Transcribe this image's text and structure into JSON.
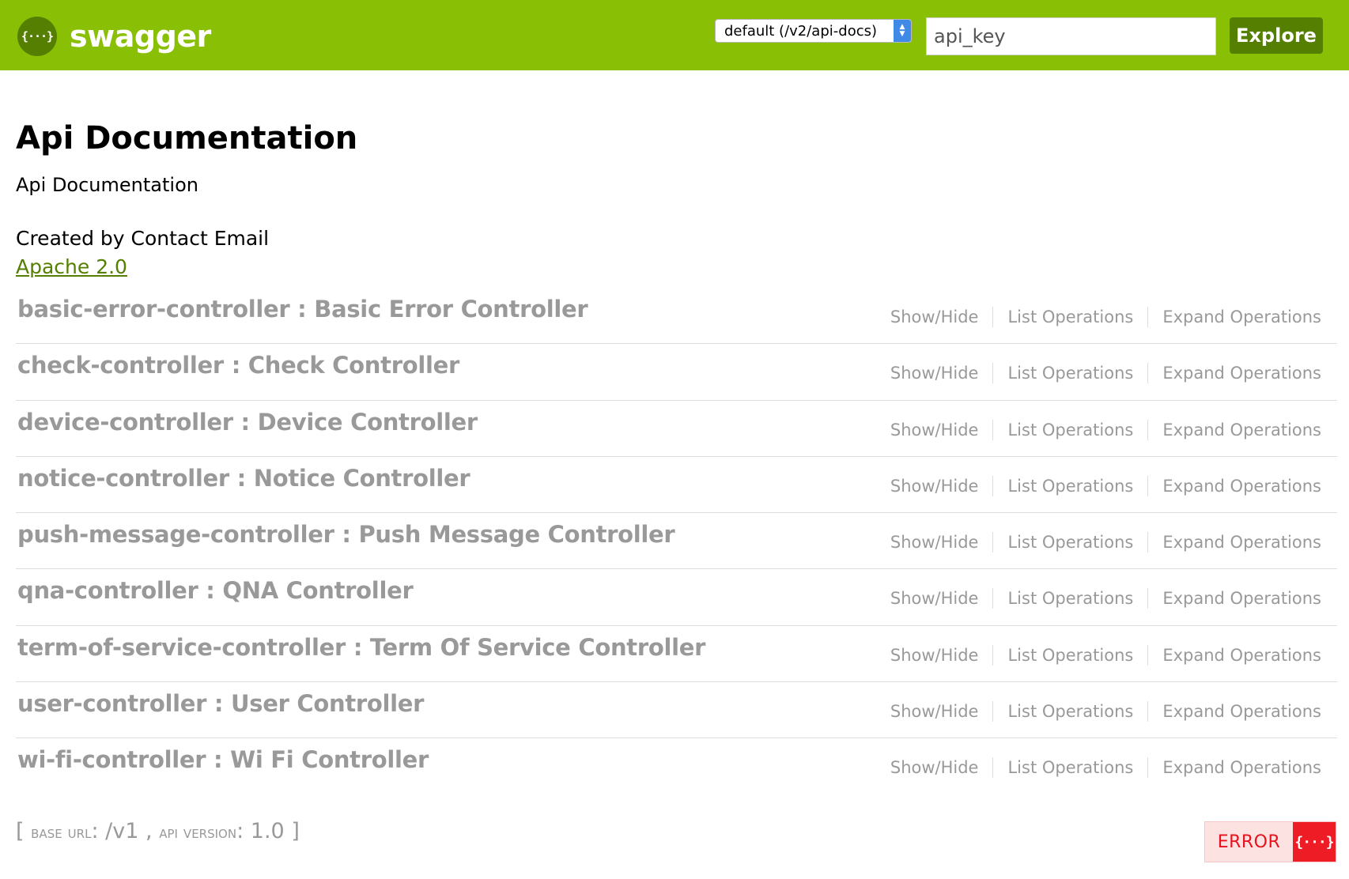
{
  "header": {
    "logo_icon": "swagger-braces-icon",
    "logo_icon_glyph": "{···}",
    "logo_text": "swagger",
    "spec_select": {
      "value": "default (/v2/api-docs)"
    },
    "api_key": {
      "value": "",
      "placeholder": "api_key"
    },
    "explore_label": "Explore",
    "colors": {
      "bar": "#89bf04",
      "button": "#547f00"
    }
  },
  "info": {
    "title": "Api Documentation",
    "description": "Api Documentation",
    "contact": "Created by Contact Email",
    "license": "Apache 2.0"
  },
  "operation_labels": {
    "show_hide": "Show/Hide",
    "list": "List Operations",
    "expand": "Expand Operations"
  },
  "resources": [
    {
      "heading": "basic-error-controller : Basic Error Controller"
    },
    {
      "heading": "check-controller : Check Controller"
    },
    {
      "heading": "device-controller : Device Controller"
    },
    {
      "heading": "notice-controller : Notice Controller"
    },
    {
      "heading": "push-message-controller : Push Message Controller"
    },
    {
      "heading": "qna-controller : QNA Controller"
    },
    {
      "heading": "term-of-service-controller : Term Of Service Controller"
    },
    {
      "heading": "user-controller : User Controller"
    },
    {
      "heading": "wi-fi-controller : Wi Fi Controller"
    }
  ],
  "footer": {
    "open_bracket": "[",
    "base_url_label": "base url",
    "base_url_value": "/v1",
    "separator": ",",
    "api_version_label": "api version",
    "api_version_value": "1.0",
    "close_bracket": "]"
  },
  "validator": {
    "label": "ERROR",
    "icon": "swagger-braces-icon",
    "icon_glyph": "{···}",
    "colors": {
      "label_bg": "#fde2e2",
      "label_text": "#e8121d",
      "icon_bg": "#ee1c25"
    }
  }
}
